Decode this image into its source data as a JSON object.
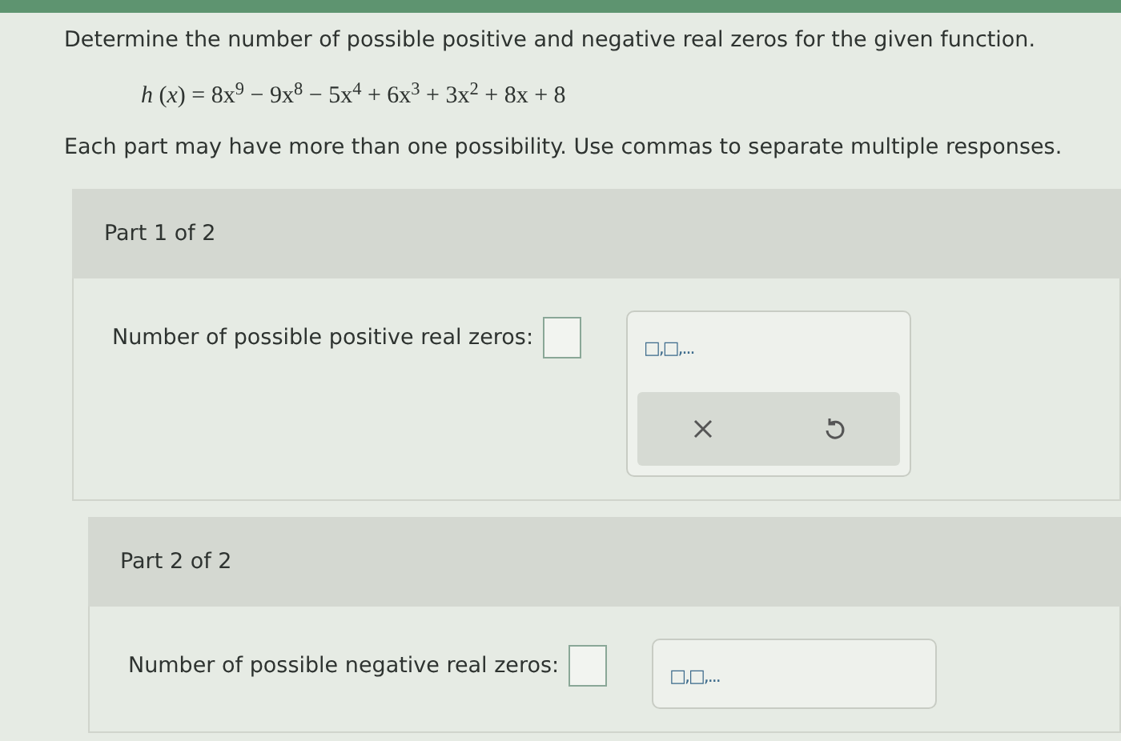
{
  "question": {
    "instruction": "Determine the number of possible positive and negative real zeros for the given function.",
    "function": "*h* (*x*) = 8x$^{9}$ − 9x$^{8}$ − 5x$^{4}$ + 6x$^{3}$ + 3x$^{2}$ + 8x + 8",
    "note": "Each part may have more than one possibility. Use commas to separate multiple responses."
  },
  "parts": [
    {
      "title": "Part 1 of 2",
      "prompt": "Number of possible positive real zeros:",
      "template": "□,□,...",
      "tools_shown": true
    },
    {
      "title": "Part 2 of 2",
      "prompt": "Number of possible negative real zeros:",
      "template": "□,□,...",
      "tools_shown": false
    }
  ]
}
